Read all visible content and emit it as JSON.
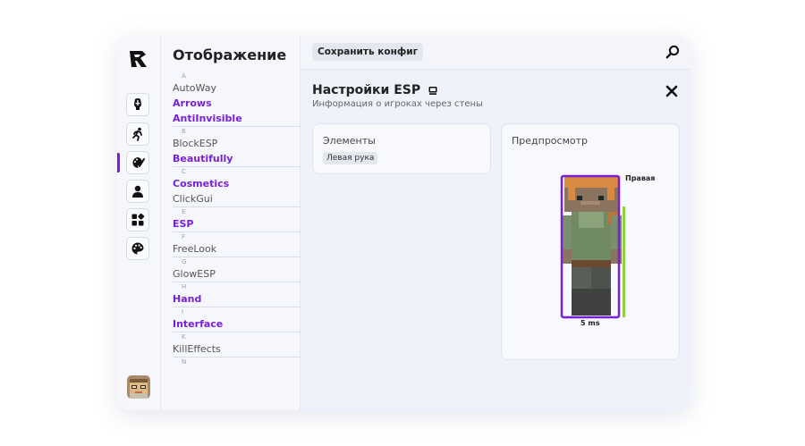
{
  "colors": {
    "accent": "#7a1fd6",
    "health": "#8ed13c"
  },
  "sidebar": {
    "icons": [
      "knight-icon",
      "running-man-icon",
      "palette-brush-icon",
      "person-icon",
      "grid-icon",
      "palette-icon"
    ],
    "active": "palette-brush-icon"
  },
  "modlist": {
    "title": "Отображение",
    "groups": [
      {
        "letter": "A",
        "mods": [
          {
            "name": "AutoWay",
            "on": false
          },
          {
            "name": "Arrows",
            "on": true
          },
          {
            "name": "AntiInvisible",
            "on": true
          }
        ]
      },
      {
        "letter": "B",
        "mods": [
          {
            "name": "BlockESP",
            "on": false
          },
          {
            "name": "Beautifully",
            "on": true
          }
        ]
      },
      {
        "letter": "C",
        "mods": [
          {
            "name": "Cosmetics",
            "on": true
          },
          {
            "name": "ClickGui",
            "on": false
          }
        ]
      },
      {
        "letter": "E",
        "mods": [
          {
            "name": "ESP",
            "on": true
          }
        ]
      },
      {
        "letter": "F",
        "mods": [
          {
            "name": "FreeLook",
            "on": false
          }
        ]
      },
      {
        "letter": "G",
        "mods": [
          {
            "name": "GlowESP",
            "on": false
          }
        ]
      },
      {
        "letter": "H",
        "mods": [
          {
            "name": "Hand",
            "on": true
          }
        ]
      },
      {
        "letter": "I",
        "mods": [
          {
            "name": "Interface",
            "on": true
          }
        ]
      },
      {
        "letter": "K",
        "mods": [
          {
            "name": "KillEffects",
            "on": false
          }
        ]
      },
      {
        "letter": "N",
        "mods": []
      }
    ]
  },
  "toolbar": {
    "save_label": "Сохранить конфиг"
  },
  "settings": {
    "title": "Настройки ESP",
    "subtitle": "Информация о игроках через стены",
    "elements_title": "Элементы",
    "elements_chip": "Левая рука",
    "preview_title": "Предпросмотр",
    "preview_hand_label": "Правая",
    "preview_ping_label": "5 ms"
  }
}
